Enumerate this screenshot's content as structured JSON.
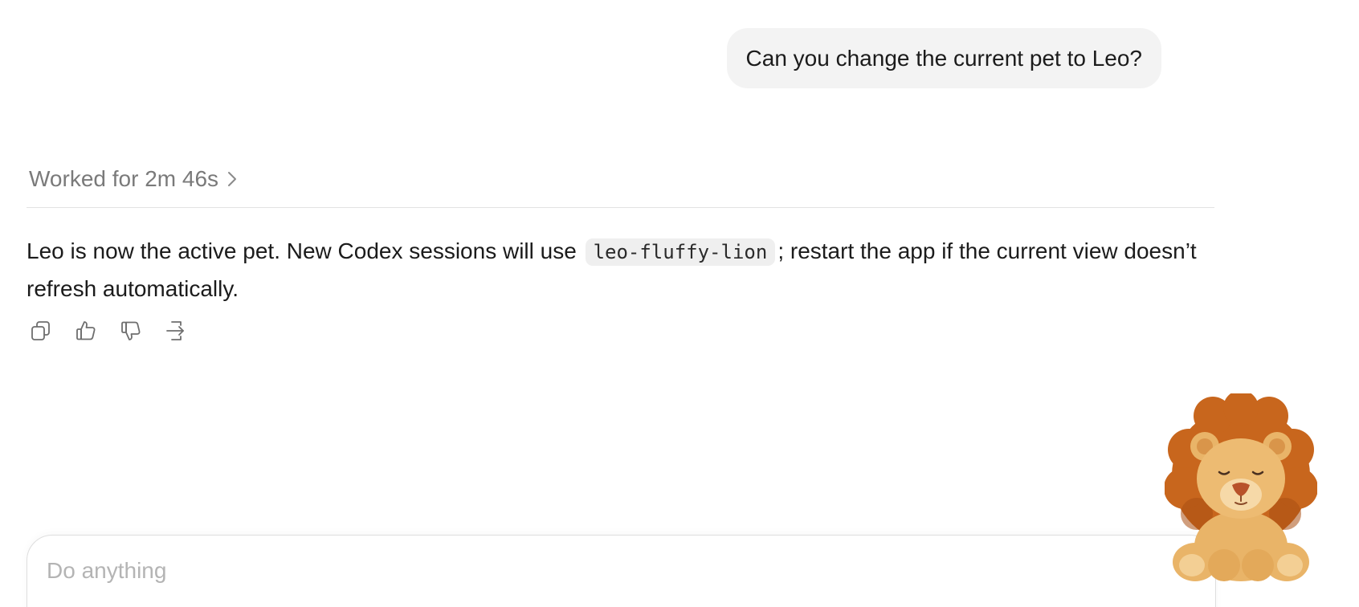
{
  "conversation": {
    "user_message": "Can you change the current pet to Leo?",
    "worked_label": "Worked for 2m 46s",
    "assistant_message": {
      "text_before": "Leo is now the active pet. New Codex sessions will use ",
      "code": "leo-fluffy-lion",
      "text_after": "; restart the app if the current view doesn’t refresh automatically."
    }
  },
  "message_actions": [
    {
      "icon": "copy-icon"
    },
    {
      "icon": "thumbs-up-icon"
    },
    {
      "icon": "thumbs-down-icon"
    },
    {
      "icon": "branch-icon"
    }
  ],
  "composer": {
    "placeholder": "Do anything"
  },
  "pet": {
    "icon": "lion-plush-icon"
  },
  "colors": {
    "user_bubble": "#f3f3f3",
    "muted_text": "#7a7a7a",
    "code_bg": "#efefef",
    "lion_mane": "#c8661d",
    "lion_body": "#e9b468"
  }
}
